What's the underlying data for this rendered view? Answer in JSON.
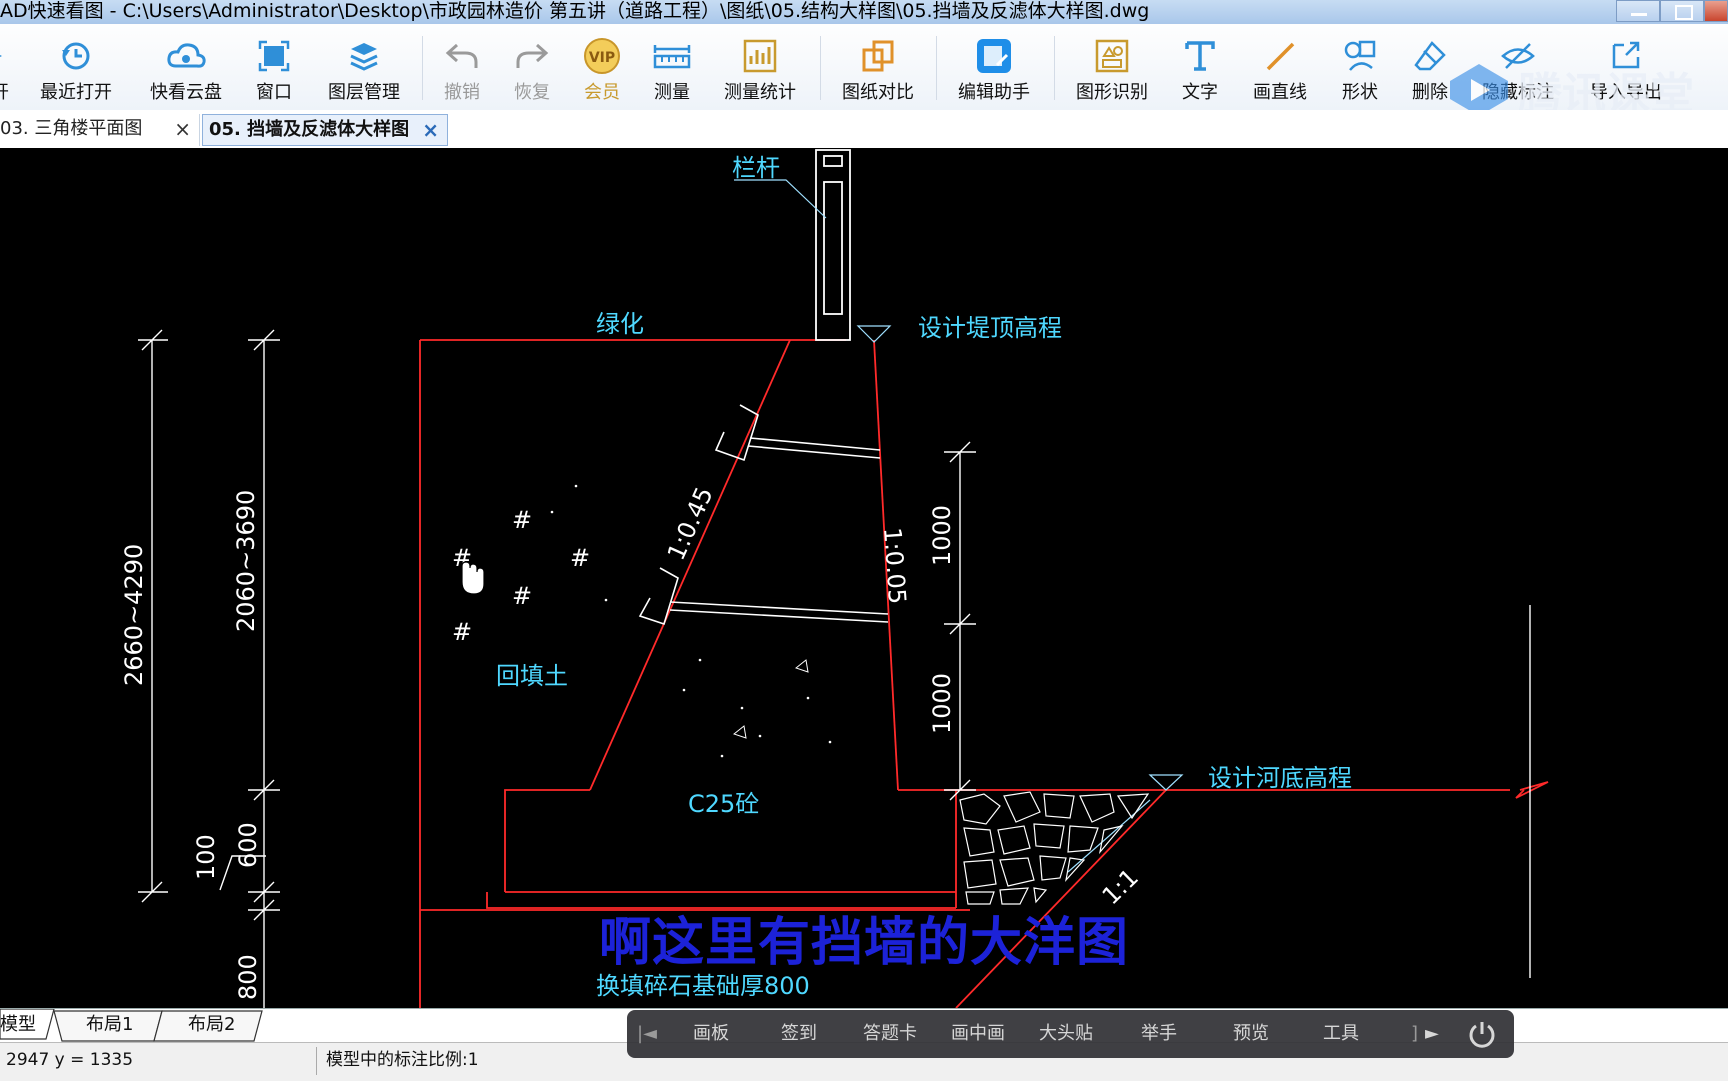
{
  "window": {
    "title": "AD快速看图 - C:\\Users\\Administrator\\Desktop\\市政园林造价  第五讲（道路工程）\\图纸\\05.结构大样图\\05.挡墙及反滤体大样图.dwg"
  },
  "toolbar": {
    "items": [
      {
        "label": "开",
        "icon": "open-icon"
      },
      {
        "label": "最近打开",
        "icon": "recent-icon"
      },
      {
        "label": "快看云盘",
        "icon": "cloud-icon"
      },
      {
        "label": "窗口",
        "icon": "window-icon"
      },
      {
        "label": "图层管理",
        "icon": "layers-icon"
      },
      {
        "label": "撤销",
        "icon": "undo-icon"
      },
      {
        "label": "恢复",
        "icon": "redo-icon"
      },
      {
        "label": "会员",
        "icon": "vip-icon"
      },
      {
        "label": "测量",
        "icon": "ruler-icon"
      },
      {
        "label": "测量统计",
        "icon": "measure-stats-icon"
      },
      {
        "label": "图纸对比",
        "icon": "compare-icon"
      },
      {
        "label": "编辑助手",
        "icon": "cad-edit-icon"
      },
      {
        "label": "图形识别",
        "icon": "shape-recognize-icon"
      },
      {
        "label": "文字",
        "icon": "text-icon"
      },
      {
        "label": "画直线",
        "icon": "line-icon"
      },
      {
        "label": "形状",
        "icon": "shape-icon"
      },
      {
        "label": "删除",
        "icon": "eraser-icon"
      },
      {
        "label": "隐藏标注",
        "icon": "hide-annotation-icon"
      },
      {
        "label": "导入导出",
        "icon": "import-export-icon"
      }
    ],
    "vip_badge": "VIP"
  },
  "watermark": {
    "text": "腾讯课堂"
  },
  "tabs": [
    {
      "label": "03. 三角楼平面图",
      "close": "×"
    },
    {
      "label": "05. 挡墙及反滤体大样图",
      "close": "×"
    }
  ],
  "drawing": {
    "railing": "栏杆",
    "greening": "绿化",
    "top_elevation": "设计堤顶高程",
    "bottom_elevation": "设计河底高程",
    "backfill": "回填土",
    "concrete": "C25砼",
    "foundation": "换填碎石基础厚800",
    "slope_back": "1:0.45",
    "slope_front": "1:0.05",
    "slope_filter": "1:1",
    "dim_outer": "2660~4290",
    "dim_inner": "2060~3690",
    "dim_upper": "1000",
    "dim_lower": "1000",
    "dim_600": "600",
    "dim_100": "100",
    "dim_800": "800",
    "hash": "#"
  },
  "subtitle": "啊这里有挡墙的大洋图",
  "layout_tabs": [
    "模型",
    "布局1",
    "布局2"
  ],
  "status": {
    "coords": "2947 y = 1335",
    "scale": "模型中的标注比例:1"
  },
  "meeting": {
    "items": [
      "画板",
      "签到",
      "答题卡",
      "画中画",
      "大头贴",
      "举手",
      "预览",
      "工具"
    ],
    "more": "]"
  }
}
